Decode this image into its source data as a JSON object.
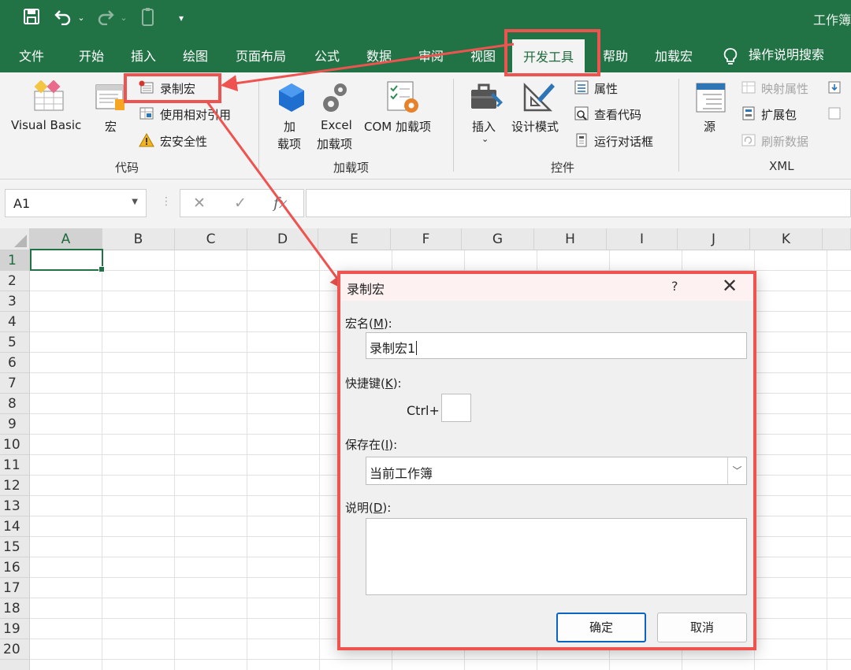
{
  "titlebar": {
    "workbook_title": "工作簿",
    "icons": [
      "save-icon",
      "undo-icon",
      "redo-icon",
      "touch-mode-icon",
      "customize-qat-icon"
    ]
  },
  "menu": {
    "tabs": [
      "文件",
      "开始",
      "插入",
      "绘图",
      "页面布局",
      "公式",
      "数据",
      "审阅",
      "视图",
      "开发工具",
      "帮助",
      "加载宏"
    ],
    "active_tab": "开发工具",
    "tell_me": "操作说明搜索"
  },
  "ribbon": {
    "code": {
      "title": "代码",
      "visual_basic": "Visual Basic",
      "macros": "宏",
      "record_macro": "录制宏",
      "relative_refs": "使用相对引用",
      "macro_security": "宏安全性"
    },
    "addins": {
      "title": "加载项",
      "addins_line1": "加",
      "addins_line2": "载项",
      "excel_addins_line1": "Excel",
      "excel_addins_line2": "加载项",
      "com_addins": "COM 加载项"
    },
    "controls": {
      "title": "控件",
      "insert": "插入",
      "design_mode": "设计模式",
      "properties": "属性",
      "view_code": "查看代码",
      "run_dialog": "运行对话框"
    },
    "xml": {
      "title": "XML",
      "source": "源",
      "map_properties": "映射属性",
      "expansion_packs": "扩展包",
      "refresh_data": "刷新数据"
    }
  },
  "formula_bar": {
    "name_box": "A1",
    "cancel": "✕",
    "enter": "✓",
    "fx": "fx",
    "formula": ""
  },
  "grid": {
    "columns": [
      "A",
      "B",
      "C",
      "D",
      "E",
      "F",
      "G",
      "H",
      "I",
      "J",
      "K"
    ],
    "rows": [
      "1",
      "2",
      "3",
      "4",
      "5",
      "6",
      "7",
      "8",
      "9",
      "10",
      "11",
      "12",
      "13",
      "14",
      "15",
      "16",
      "17",
      "18",
      "19",
      "20"
    ],
    "active_cell": "A1"
  },
  "dialog": {
    "title": "录制宏",
    "help": "?",
    "close": "✕",
    "macro_name_label": "宏名(",
    "macro_name_key": "M",
    "macro_name_suffix": "):",
    "macro_name_value": "录制宏1",
    "shortcut_label": "快捷键(",
    "shortcut_key": "K",
    "shortcut_suffix": "):",
    "ctrl_prefix": "Ctrl+",
    "shortcut_value": "",
    "store_label": "保存在(",
    "store_key": "I",
    "store_suffix": "):",
    "store_value": "当前工作簿",
    "description_label": "说明(",
    "description_key": "D",
    "description_suffix": "):",
    "description_value": "",
    "ok": "确定",
    "cancel": "取消"
  },
  "colors": {
    "excel_green": "#217346",
    "highlight_red": "#ef5350",
    "ribbon_bg": "#f3f3f3"
  }
}
